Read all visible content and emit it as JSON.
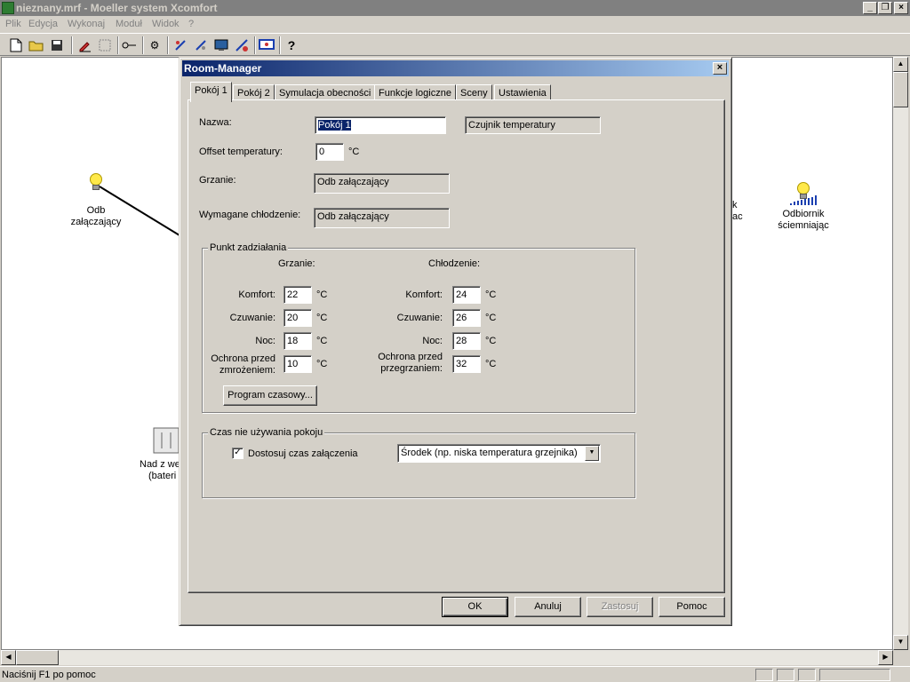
{
  "app": {
    "title": "nieznany.mrf - Moeller system Xcomfort",
    "menu": [
      "Plik",
      "Edycja",
      "Wykonaj",
      "Moduł",
      "Widok",
      "?"
    ],
    "status": "Naciśnij F1 po pomoc"
  },
  "canvas": {
    "devices": [
      {
        "label1": "Odb",
        "label2": "załączający"
      },
      {
        "label1": "Odbiornik",
        "label2": "ściemniając"
      },
      {
        "label1": "Nad z we",
        "label2": "(bateri"
      },
      {
        "label1": "k",
        "label2": "ac"
      }
    ]
  },
  "dialog": {
    "title": "Room-Manager",
    "tabs": [
      "Pokój 1",
      "Pokój 2",
      "Symulacja obecności",
      "Funkcje logiczne",
      "Sceny",
      "Ustawienia"
    ],
    "fields": {
      "name_label": "Nazwa:",
      "name_value": "Pokój 1",
      "sensor_value": "Czujnik temperatury",
      "offset_label": "Offset temperatury:",
      "offset_value": "0",
      "unit": "°C",
      "heating_label": "Grzanie:",
      "heating_value": "Odb załączający",
      "cooling_label": "Wymagane chłodzenie:",
      "cooling_value": "Odb załączający"
    },
    "setpoints": {
      "title": "Punkt zadziałania",
      "heating_header": "Grzanie:",
      "cooling_header": "Chłodzenie:",
      "heating": [
        {
          "label": "Komfort:",
          "value": "22"
        },
        {
          "label": "Czuwanie:",
          "value": "20"
        },
        {
          "label": "Noc:",
          "value": "18"
        },
        {
          "label": "Ochrona przed zmrożeniem:",
          "label1": "Ochrona przed",
          "label2": "zmrożeniem:",
          "value": "10"
        }
      ],
      "cooling": [
        {
          "label": "Komfort:",
          "value": "24"
        },
        {
          "label": "Czuwanie:",
          "value": "26"
        },
        {
          "label": "Noc:",
          "value": "28"
        },
        {
          "label": "Ochrona przed przegrzaniem:",
          "label1": "Ochrona przed",
          "label2": "przegrzaniem:",
          "value": "32"
        }
      ],
      "schedule_button": "Program czasowy..."
    },
    "idle": {
      "title": "Czas nie używania pokoju",
      "checkbox_label": "Dostosuj czas załączenia",
      "checkbox_checked": true,
      "dropdown_value": "Środek (np. niska temperatura grzejnika)"
    },
    "buttons": {
      "ok": "OK",
      "cancel": "Anuluj",
      "apply": "Zastosuj",
      "help": "Pomoc"
    }
  }
}
